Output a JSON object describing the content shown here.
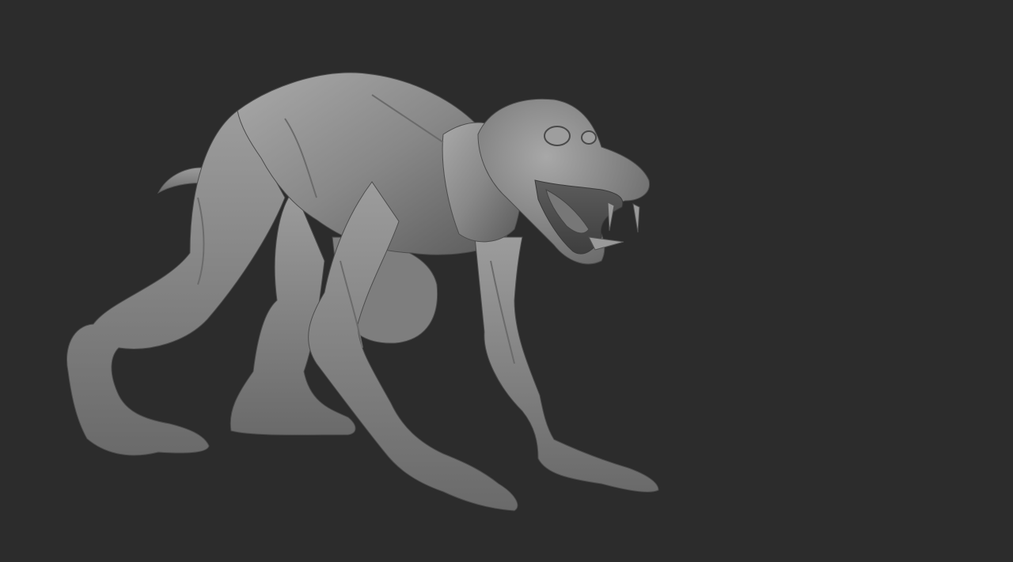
{
  "viewport": {
    "background_color": "#2c2c2c",
    "model": {
      "material_color": "#8a8a8a",
      "highlight_color": "#b0b0b0",
      "shadow_color": "#4a4a4a"
    }
  }
}
